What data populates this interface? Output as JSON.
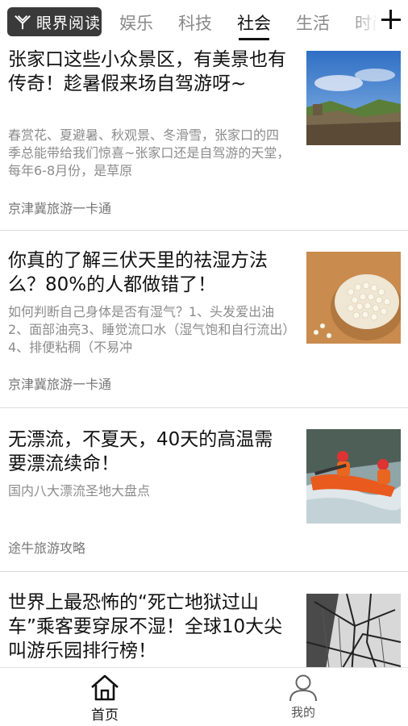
{
  "header": {
    "logo_text": "眼界阅读",
    "tabs": [
      "娱乐",
      "科技",
      "社会",
      "生活",
      "时尚"
    ],
    "active_tab": "社会"
  },
  "articles": [
    {
      "title": "张家口这些小众景区，有美景也有传奇！趁暑假来场自驾游呀~",
      "summary": "春赏花、夏避暑、秋观景、冬滑雪，张家口的四季总能带给我们惊喜~张家口还是自驾游的天堂，每年6-8月份，是草原",
      "source": "京津冀旅游一卡通",
      "thumb": "great-wall-image"
    },
    {
      "title": "你真的了解三伏天里的祛湿方法么？80%的人都做错了！",
      "summary": "如何判断自己身体是否有湿气？1、头发爱出油2、面部油亮3、睡觉流口水（湿气饱和自行流出）4、排便粘稠（不易冲",
      "source": "京津冀旅游一卡通",
      "thumb": "barley-bowl-image"
    },
    {
      "title": "无漂流，不夏天，40天的高温需要漂流续命！",
      "summary": "国内八大漂流圣地大盘点",
      "source": "途牛旅游攻略",
      "thumb": "rafting-image"
    },
    {
      "title": "世界上最恐怖的“死亡地狱过山车”乘客要穿尿不湿！全球10大尖叫游乐园排行榜！",
      "summary": "",
      "source": "",
      "thumb": "roller-coaster-image"
    }
  ],
  "bottom_nav": {
    "home_label": "首页",
    "mine_label": "我的"
  }
}
